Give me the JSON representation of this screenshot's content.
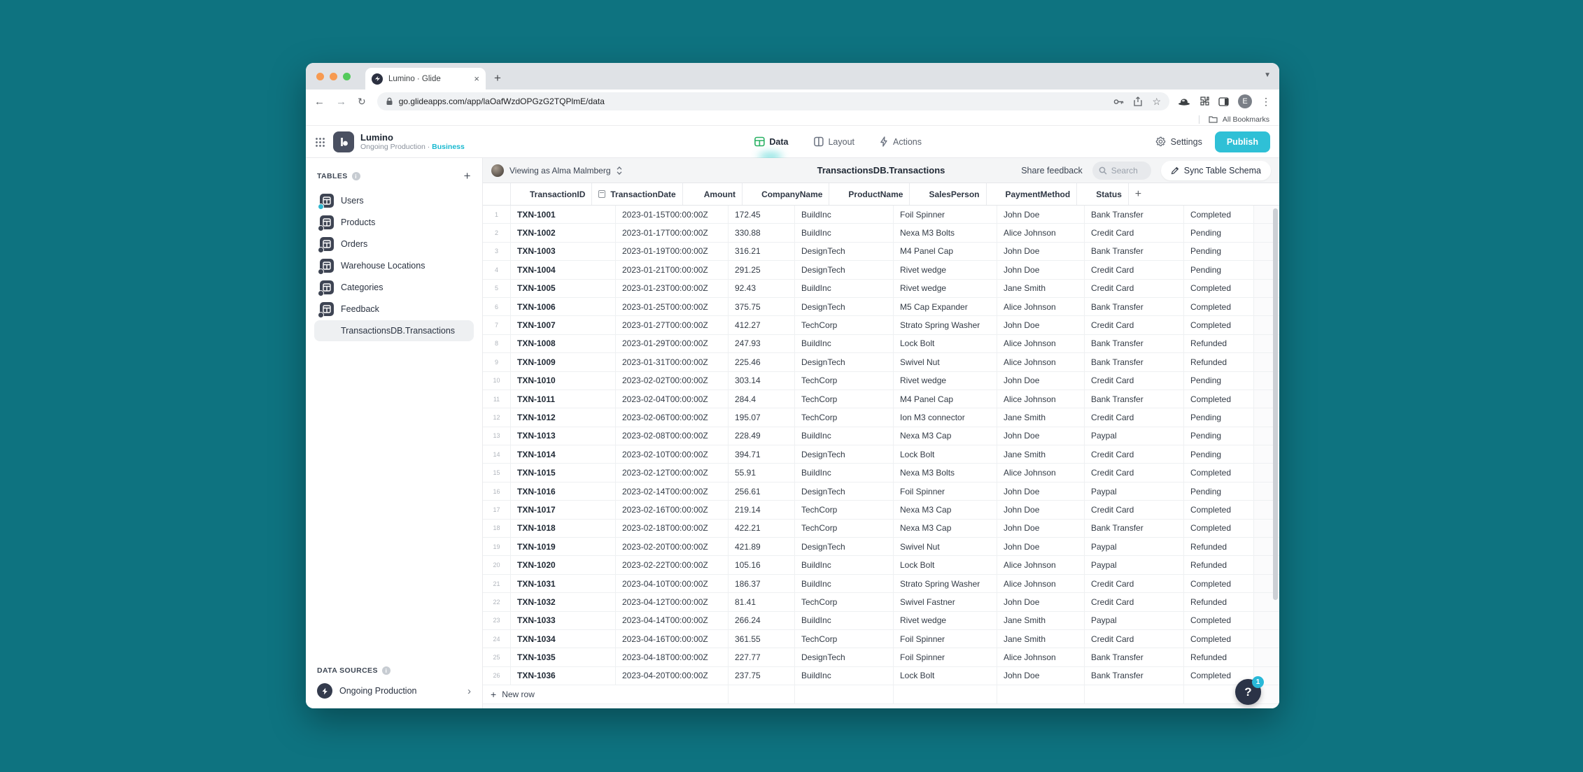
{
  "colors": {
    "desktop_background": "#0e7380",
    "accent_teal": "#2fc0d6",
    "data_tab_green": "#28b162",
    "plan_cyan": "#19b9d0"
  },
  "icons": {
    "plus": "+",
    "close": "×",
    "back": "←",
    "forward": "→",
    "reload": "↻",
    "star": "☆",
    "overflow": "⋮",
    "chevron_right": "›",
    "chevron_down": "⌄",
    "question": "?"
  },
  "browser": {
    "tab_title": "Lumino · Glide",
    "url": "go.glideapps.com/app/laOafWzdOPGzG2TQPlmE/data",
    "profile_initial": "E",
    "all_bookmarks_label": "All Bookmarks"
  },
  "header": {
    "app_name": "Lumino",
    "app_subtitle": "Ongoing Production · ",
    "app_plan": "Business",
    "tabs": [
      {
        "label": "Data",
        "icon": "data",
        "active": true
      },
      {
        "label": "Layout",
        "icon": "layout",
        "active": false
      },
      {
        "label": "Actions",
        "icon": "actions",
        "active": false
      }
    ],
    "settings_label": "Settings",
    "publish_label": "Publish"
  },
  "sidebar": {
    "tables_heading": "TABLES",
    "items": [
      {
        "label": "Users",
        "users": true
      },
      {
        "label": "Products"
      },
      {
        "label": "Orders"
      },
      {
        "label": "Warehouse Locations"
      },
      {
        "label": "Categories"
      },
      {
        "label": "Feedback"
      },
      {
        "label": "TransactionsDB.Transactions",
        "selected": true,
        "cloud": true
      }
    ],
    "data_sources_heading": "DATA SOURCES",
    "data_source_label": "Ongoing Production"
  },
  "toolbar": {
    "viewing_as": "Viewing as Alma Malmberg",
    "title": "TransactionsDB.Transactions",
    "share_feedback": "Share feedback",
    "search_placeholder": "Search",
    "sync_button": "Sync Table Schema"
  },
  "table": {
    "columns": [
      {
        "label": "TransactionID",
        "type": "text"
      },
      {
        "label": "TransactionDate",
        "type": "date"
      },
      {
        "label": "Amount",
        "type": "number"
      },
      {
        "label": "CompanyName",
        "type": "text"
      },
      {
        "label": "ProductName",
        "type": "text"
      },
      {
        "label": "SalesPerson",
        "type": "text"
      },
      {
        "label": "PaymentMethod",
        "type": "text"
      },
      {
        "label": "Status",
        "type": "text"
      }
    ],
    "rows": [
      {
        "n": "1",
        "id": "TXN-1001",
        "date": "2023-01-15T00:00:00Z",
        "amount": "172.45",
        "company": "BuildInc",
        "product": "Foil Spinner",
        "sales": "John Doe",
        "payment": "Bank Transfer",
        "status": "Completed"
      },
      {
        "n": "2",
        "id": "TXN-1002",
        "date": "2023-01-17T00:00:00Z",
        "amount": "330.88",
        "company": "BuildInc",
        "product": "Nexa M3 Bolts",
        "sales": "Alice Johnson",
        "payment": "Credit Card",
        "status": "Pending"
      },
      {
        "n": "3",
        "id": "TXN-1003",
        "date": "2023-01-19T00:00:00Z",
        "amount": "316.21",
        "company": "DesignTech",
        "product": "M4 Panel Cap",
        "sales": "John Doe",
        "payment": "Bank Transfer",
        "status": "Pending"
      },
      {
        "n": "4",
        "id": "TXN-1004",
        "date": "2023-01-21T00:00:00Z",
        "amount": "291.25",
        "company": "DesignTech",
        "product": "Rivet wedge",
        "sales": "John Doe",
        "payment": "Credit Card",
        "status": "Pending"
      },
      {
        "n": "5",
        "id": "TXN-1005",
        "date": "2023-01-23T00:00:00Z",
        "amount": "92.43",
        "company": "BuildInc",
        "product": "Rivet wedge",
        "sales": "Jane Smith",
        "payment": "Credit Card",
        "status": "Completed"
      },
      {
        "n": "6",
        "id": "TXN-1006",
        "date": "2023-01-25T00:00:00Z",
        "amount": "375.75",
        "company": "DesignTech",
        "product": "M5 Cap Expander",
        "sales": "Alice Johnson",
        "payment": "Bank Transfer",
        "status": "Completed"
      },
      {
        "n": "7",
        "id": "TXN-1007",
        "date": "2023-01-27T00:00:00Z",
        "amount": "412.27",
        "company": "TechCorp",
        "product": "Strato Spring Washer",
        "sales": "John Doe",
        "payment": "Credit Card",
        "status": "Completed"
      },
      {
        "n": "8",
        "id": "TXN-1008",
        "date": "2023-01-29T00:00:00Z",
        "amount": "247.93",
        "company": "BuildInc",
        "product": "Lock Bolt",
        "sales": "Alice Johnson",
        "payment": "Bank Transfer",
        "status": "Refunded"
      },
      {
        "n": "9",
        "id": "TXN-1009",
        "date": "2023-01-31T00:00:00Z",
        "amount": "225.46",
        "company": "DesignTech",
        "product": "Swivel Nut",
        "sales": "Alice Johnson",
        "payment": "Bank Transfer",
        "status": "Refunded"
      },
      {
        "n": "10",
        "id": "TXN-1010",
        "date": "2023-02-02T00:00:00Z",
        "amount": "303.14",
        "company": "TechCorp",
        "product": "Rivet wedge",
        "sales": "John Doe",
        "payment": "Credit Card",
        "status": "Pending"
      },
      {
        "n": "11",
        "id": "TXN-1011",
        "date": "2023-02-04T00:00:00Z",
        "amount": "284.4",
        "company": "TechCorp",
        "product": "M4 Panel Cap",
        "sales": "Alice Johnson",
        "payment": "Bank Transfer",
        "status": "Completed"
      },
      {
        "n": "12",
        "id": "TXN-1012",
        "date": "2023-02-06T00:00:00Z",
        "amount": "195.07",
        "company": "TechCorp",
        "product": "Ion M3 connector",
        "sales": "Jane Smith",
        "payment": "Credit Card",
        "status": "Pending"
      },
      {
        "n": "13",
        "id": "TXN-1013",
        "date": "2023-02-08T00:00:00Z",
        "amount": "228.49",
        "company": "BuildInc",
        "product": "Nexa M3 Cap",
        "sales": "John Doe",
        "payment": "Paypal",
        "status": "Pending"
      },
      {
        "n": "14",
        "id": "TXN-1014",
        "date": "2023-02-10T00:00:00Z",
        "amount": "394.71",
        "company": "DesignTech",
        "product": "Lock Bolt",
        "sales": "Jane Smith",
        "payment": "Credit Card",
        "status": "Pending"
      },
      {
        "n": "15",
        "id": "TXN-1015",
        "date": "2023-02-12T00:00:00Z",
        "amount": "55.91",
        "company": "BuildInc",
        "product": "Nexa M3 Bolts",
        "sales": "Alice Johnson",
        "payment": "Credit Card",
        "status": "Completed"
      },
      {
        "n": "16",
        "id": "TXN-1016",
        "date": "2023-02-14T00:00:00Z",
        "amount": "256.61",
        "company": "DesignTech",
        "product": "Foil Spinner",
        "sales": "John Doe",
        "payment": "Paypal",
        "status": "Pending"
      },
      {
        "n": "17",
        "id": "TXN-1017",
        "date": "2023-02-16T00:00:00Z",
        "amount": "219.14",
        "company": "TechCorp",
        "product": "Nexa M3 Cap",
        "sales": "John Doe",
        "payment": "Credit Card",
        "status": "Completed"
      },
      {
        "n": "18",
        "id": "TXN-1018",
        "date": "2023-02-18T00:00:00Z",
        "amount": "422.21",
        "company": "TechCorp",
        "product": "Nexa M3 Cap",
        "sales": "John Doe",
        "payment": "Bank Transfer",
        "status": "Completed"
      },
      {
        "n": "19",
        "id": "TXN-1019",
        "date": "2023-02-20T00:00:00Z",
        "amount": "421.89",
        "company": "DesignTech",
        "product": "Swivel Nut",
        "sales": "John Doe",
        "payment": "Paypal",
        "status": "Refunded"
      },
      {
        "n": "20",
        "id": "TXN-1020",
        "date": "2023-02-22T00:00:00Z",
        "amount": "105.16",
        "company": "BuildInc",
        "product": "Lock Bolt",
        "sales": "Alice Johnson",
        "payment": "Paypal",
        "status": "Refunded"
      },
      {
        "n": "21",
        "id": "TXN-1031",
        "date": "2023-04-10T00:00:00Z",
        "amount": "186.37",
        "company": "BuildInc",
        "product": "Strato Spring Washer",
        "sales": "Alice Johnson",
        "payment": "Credit Card",
        "status": "Completed"
      },
      {
        "n": "22",
        "id": "TXN-1032",
        "date": "2023-04-12T00:00:00Z",
        "amount": "81.41",
        "company": "TechCorp",
        "product": "Swivel Fastner",
        "sales": "John Doe",
        "payment": "Credit Card",
        "status": "Refunded"
      },
      {
        "n": "23",
        "id": "TXN-1033",
        "date": "2023-04-14T00:00:00Z",
        "amount": "266.24",
        "company": "BuildInc",
        "product": "Rivet wedge",
        "sales": "Jane Smith",
        "payment": "Paypal",
        "status": "Completed"
      },
      {
        "n": "24",
        "id": "TXN-1034",
        "date": "2023-04-16T00:00:00Z",
        "amount": "361.55",
        "company": "TechCorp",
        "product": "Foil Spinner",
        "sales": "Jane Smith",
        "payment": "Credit Card",
        "status": "Completed"
      },
      {
        "n": "25",
        "id": "TXN-1035",
        "date": "2023-04-18T00:00:00Z",
        "amount": "227.77",
        "company": "DesignTech",
        "product": "Foil Spinner",
        "sales": "Alice Johnson",
        "payment": "Bank Transfer",
        "status": "Refunded"
      },
      {
        "n": "26",
        "id": "TXN-1036",
        "date": "2023-04-20T00:00:00Z",
        "amount": "237.75",
        "company": "BuildInc",
        "product": "Lock Bolt",
        "sales": "John Doe",
        "payment": "Bank Transfer",
        "status": "Completed"
      }
    ],
    "new_row_label": "New row"
  },
  "help": {
    "badge_count": "1"
  }
}
